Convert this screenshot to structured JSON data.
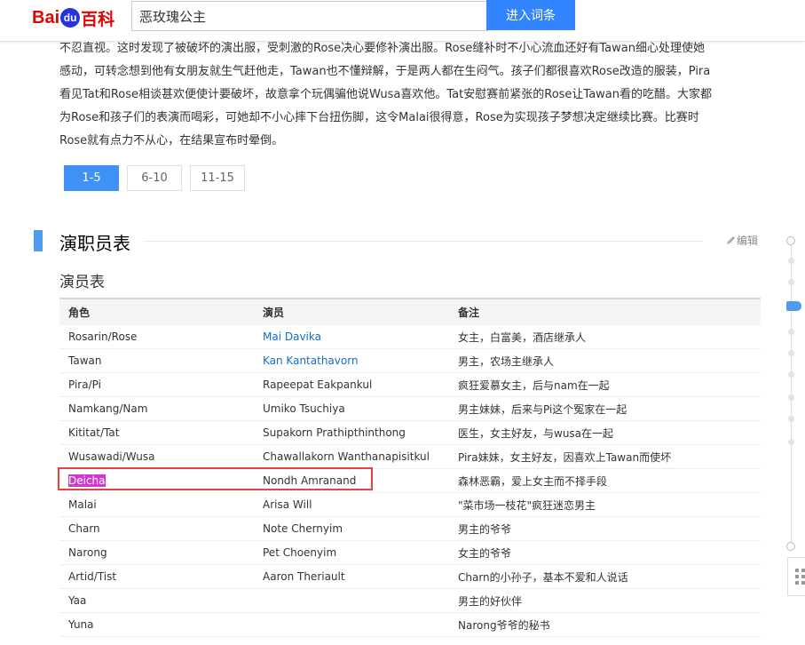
{
  "header": {
    "logo": {
      "bai": "Bai",
      "du": "du",
      "baike": "百科"
    },
    "search_value": "恶玫瑰公主",
    "search_button": "进入词条"
  },
  "plot_lines": [
    "不忍直视。这时发现了被破坏的演出服，受刺激的Rose决心要修补演出服。Rose缝补时不小心流血还好有Tawan细心处理使她",
    "感动，可转念想到他有女朋友就生气赶他走，Tawan也不懂辩解，于是两人都在生闷气。孩子们都很喜欢Rose改造的服装，Pira",
    "看见Tat和Rose相谈甚欢便使计要破坏，故意拿个玩偶骗他说Wusa喜欢他。Tat安慰赛前紧张的Rose让Tawan看的吃醋。大家都",
    "为Rose和孩子们的表演而喝彩，可她却不小心摔下台扭伤脚，这令Malai很得意，Rose为实现孩子梦想决定继续比赛。比赛时",
    "Rose就有点力不从心，在结果宣布时晕倒。"
  ],
  "pagination": [
    "1-5",
    "6-10",
    "11-15"
  ],
  "section": {
    "title": "演职员表",
    "edit": "编辑",
    "subtitle": "演员表"
  },
  "table": {
    "headers": [
      "角色",
      "演员",
      "备注"
    ],
    "rows": [
      [
        "Rosarin/Rose",
        "Mai Davika",
        "女主，白富美，酒店继承人"
      ],
      [
        "Tawan",
        "Kan Kantathavorn",
        "男主，农场主继承人"
      ],
      [
        "Pira/Pi",
        "Rapeepat Eakpankul",
        "疯狂爱慕女主，后与nam在一起"
      ],
      [
        "Namkang/Nam",
        "Umiko Tsuchiya",
        "男主妹妹，后来与Pi这个冤家在一起"
      ],
      [
        "Kititat/Tat",
        "Supakorn Prathipthinthong",
        "医生，女主好友，与wusa在一起"
      ],
      [
        "Wusawadi/Wusa",
        "Chawallakorn Wanthanapisitkul",
        "Pira妹妹，女主好友，因喜欢上Tawan而使坏"
      ],
      [
        "Deicha",
        "Nondh Amranand",
        "森林恶霸，爱上女主而不择手段"
      ],
      [
        "Malai",
        "Arisa Will",
        "\"菜市场一枝花\"疯狂迷恋男主"
      ],
      [
        "Charn",
        "Note Chernyim",
        "男主的爷爷"
      ],
      [
        "Narong",
        "Pet Choenyim",
        "女主的爷爷"
      ],
      [
        "Artid/Tist",
        "Aaron Theriault",
        "Charn的小孙子，基本不爱和人说话"
      ],
      [
        "Yaa",
        "",
        "男主的好伙伴"
      ],
      [
        "Yuna",
        "",
        "Narong爷爷的秘书"
      ]
    ]
  },
  "colors": {
    "accent": "#3385ff",
    "link": "#136ec2",
    "highlight": "#d336d3",
    "redbox": "#e84141"
  },
  "icons": [
    "pencil-icon",
    "grid-icon"
  ]
}
